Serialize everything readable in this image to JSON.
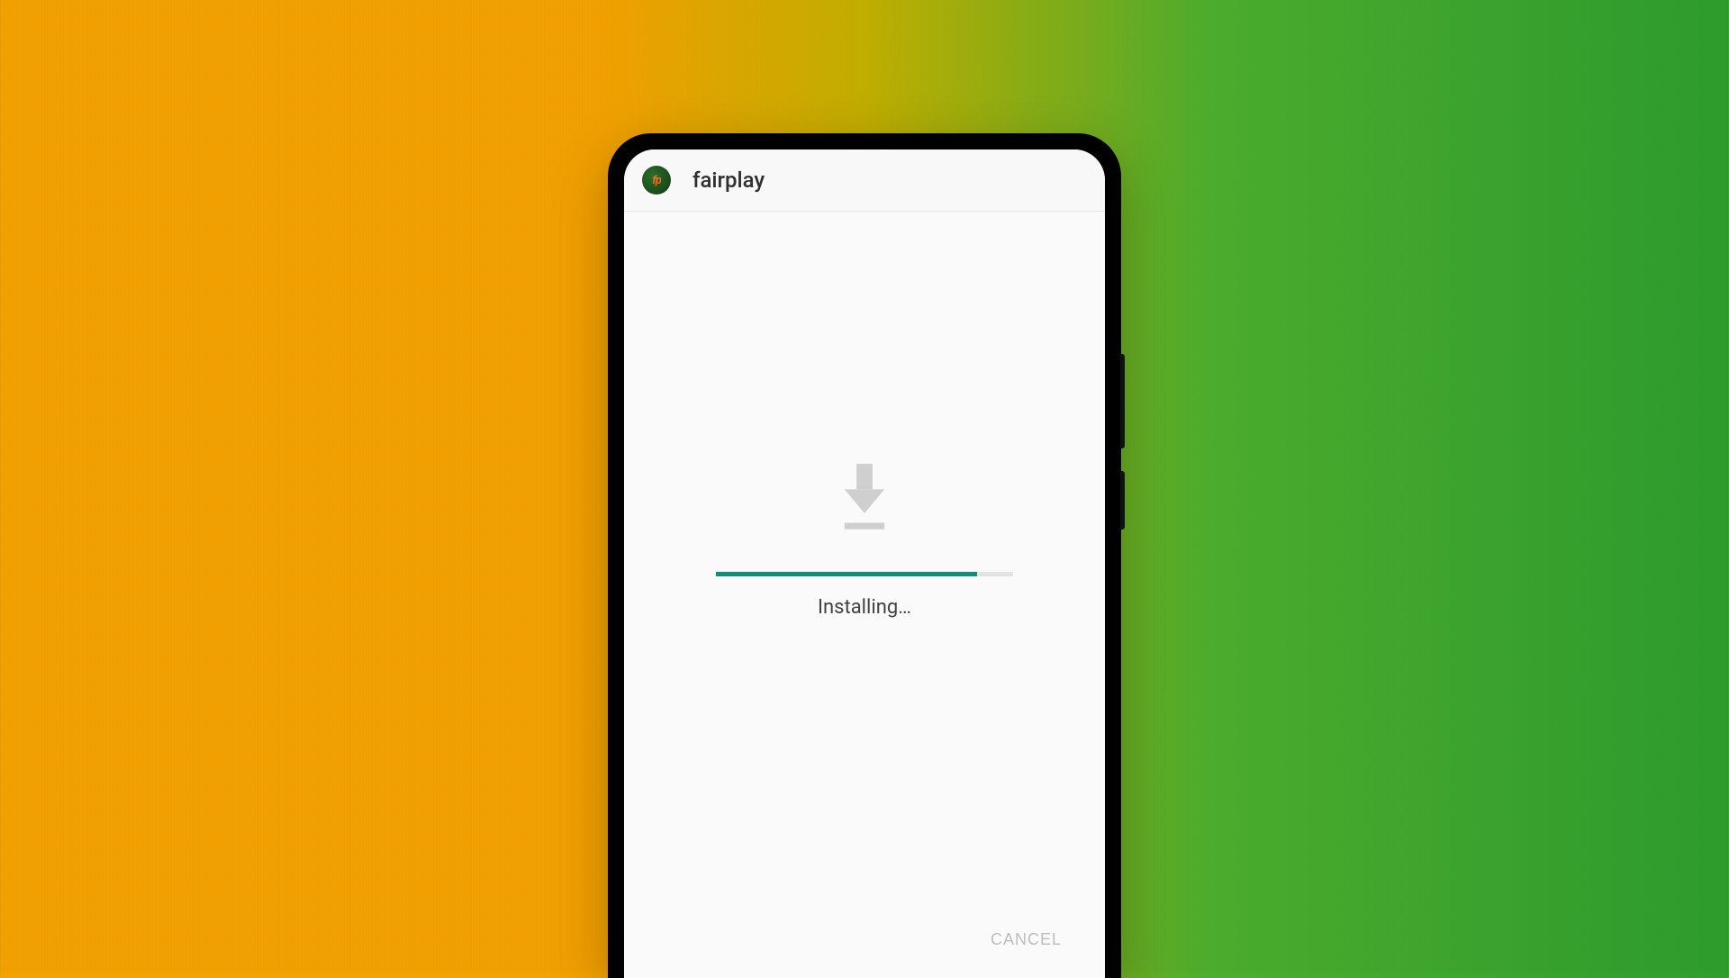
{
  "header": {
    "app_name": "fairplay",
    "icon_label": "fp"
  },
  "install": {
    "status_text": "Installing…",
    "progress_percent": 88
  },
  "actions": {
    "cancel_label": "CANCEL"
  },
  "colors": {
    "progress_fill": "#0d9077",
    "progress_track": "#e3e3e3"
  }
}
